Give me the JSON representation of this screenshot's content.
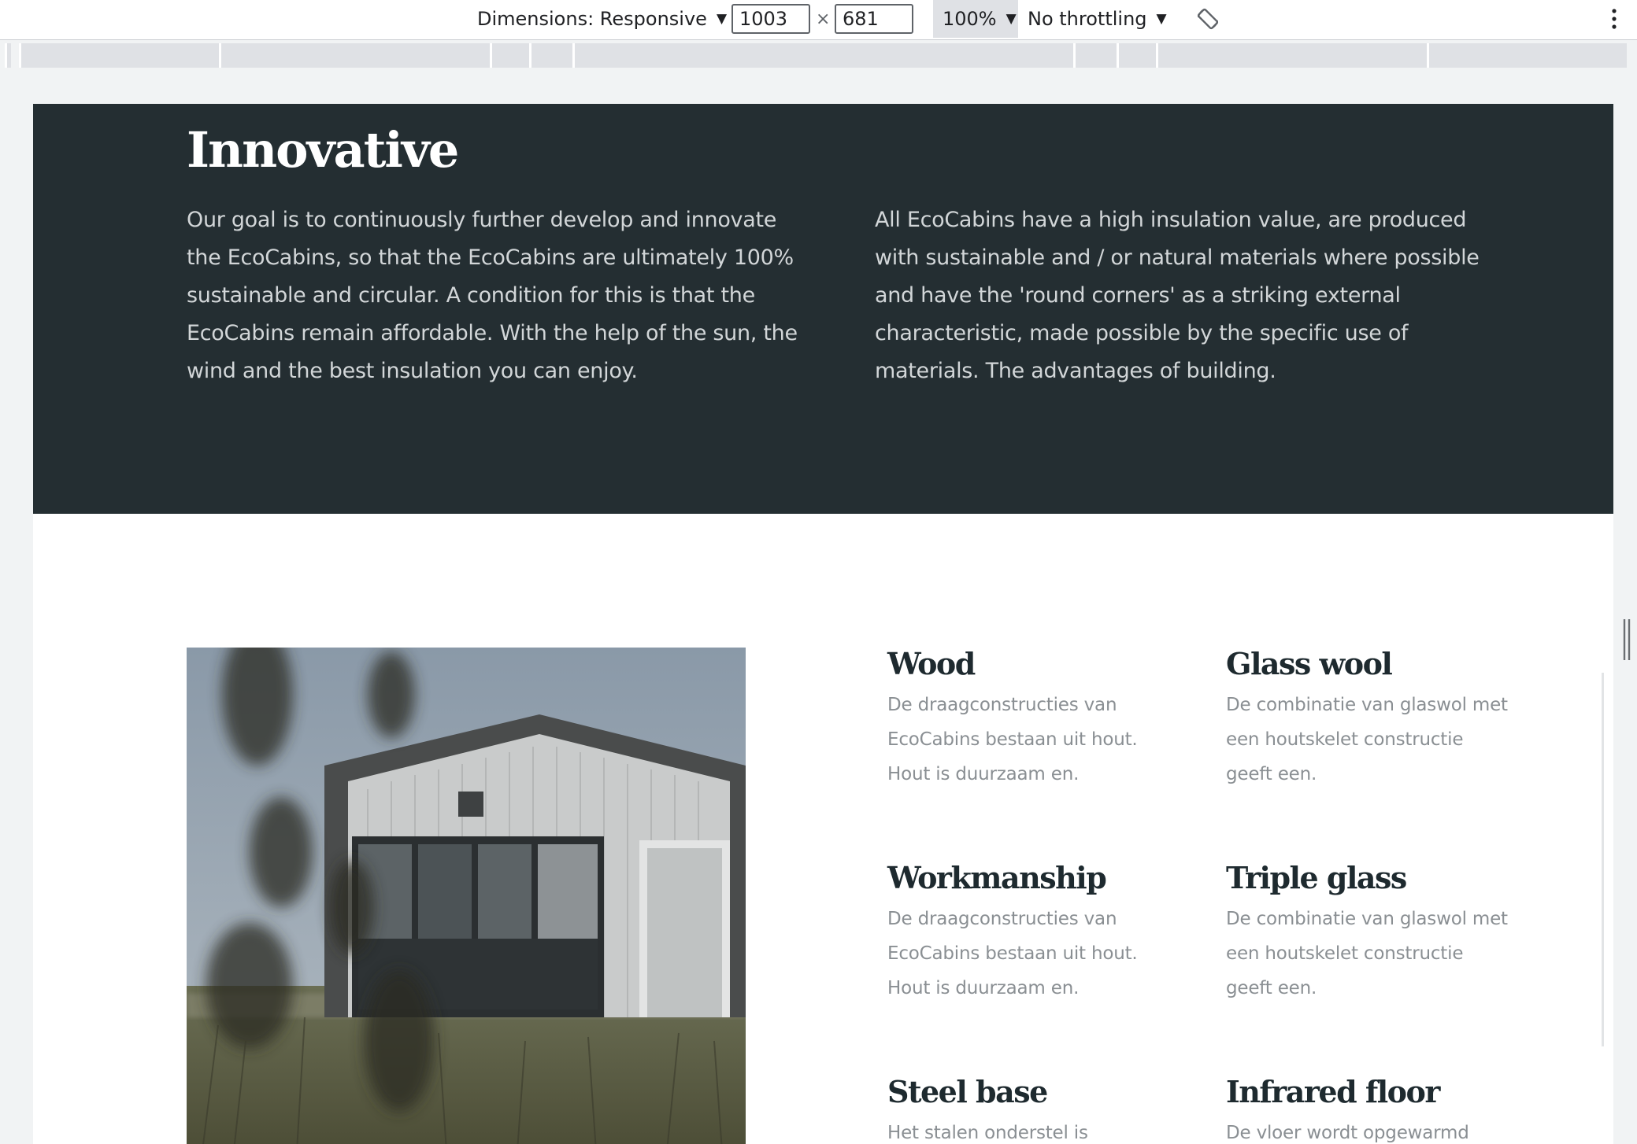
{
  "devtools": {
    "dimensions_label": "Dimensions: Responsive",
    "width_value": "1003",
    "times_symbol": "×",
    "height_value": "681",
    "zoom_value": "100%",
    "throttle_label": "No throttling",
    "caret": "▼"
  },
  "hero": {
    "title": "Innovative",
    "left_paragraph": "Our goal is to continuously further develop and innovate the EcoCabins, so that the EcoCabins are ultimately 100% sustainable and circular. A condition for this is that the EcoCabins remain affordable. With the help of the sun, the wind and the best insulation you can enjoy.",
    "right_paragraph": "All EcoCabins have a high insulation value, are produced with sustainable and / or natural materials where possible and have the 'round corners' as a striking external characteristic, made possible by the specific use of materials. The advantages of building."
  },
  "features": [
    {
      "title": "Wood",
      "text": "De draagconstructies van EcoCabins bestaan uit hout. Hout is duurzaam en."
    },
    {
      "title": "Glass wool",
      "text": "De combinatie van glaswol met een houtskelet constructie geeft een."
    },
    {
      "title": "Workmanship",
      "text": "De draagconstructies van EcoCabins bestaan uit hout. Hout is duurzaam en."
    },
    {
      "title": "Triple glass",
      "text": "De combinatie van glaswol met een houtskelet constructie geeft een."
    },
    {
      "title": "Steel base",
      "text": "Het stalen onderstel is"
    },
    {
      "title": "Infrared floor",
      "text": "De vloer wordt opgewarmd"
    }
  ],
  "colors": {
    "dark_section": "#242e32",
    "heading_on_dark": "#ffffff",
    "body_on_dark": "#d2d6d8",
    "feature_title": "#1e2a2f",
    "feature_text": "#8a8f93"
  },
  "icons": {
    "rotate": "rotate-icon",
    "more": "more-vertical-icon"
  }
}
